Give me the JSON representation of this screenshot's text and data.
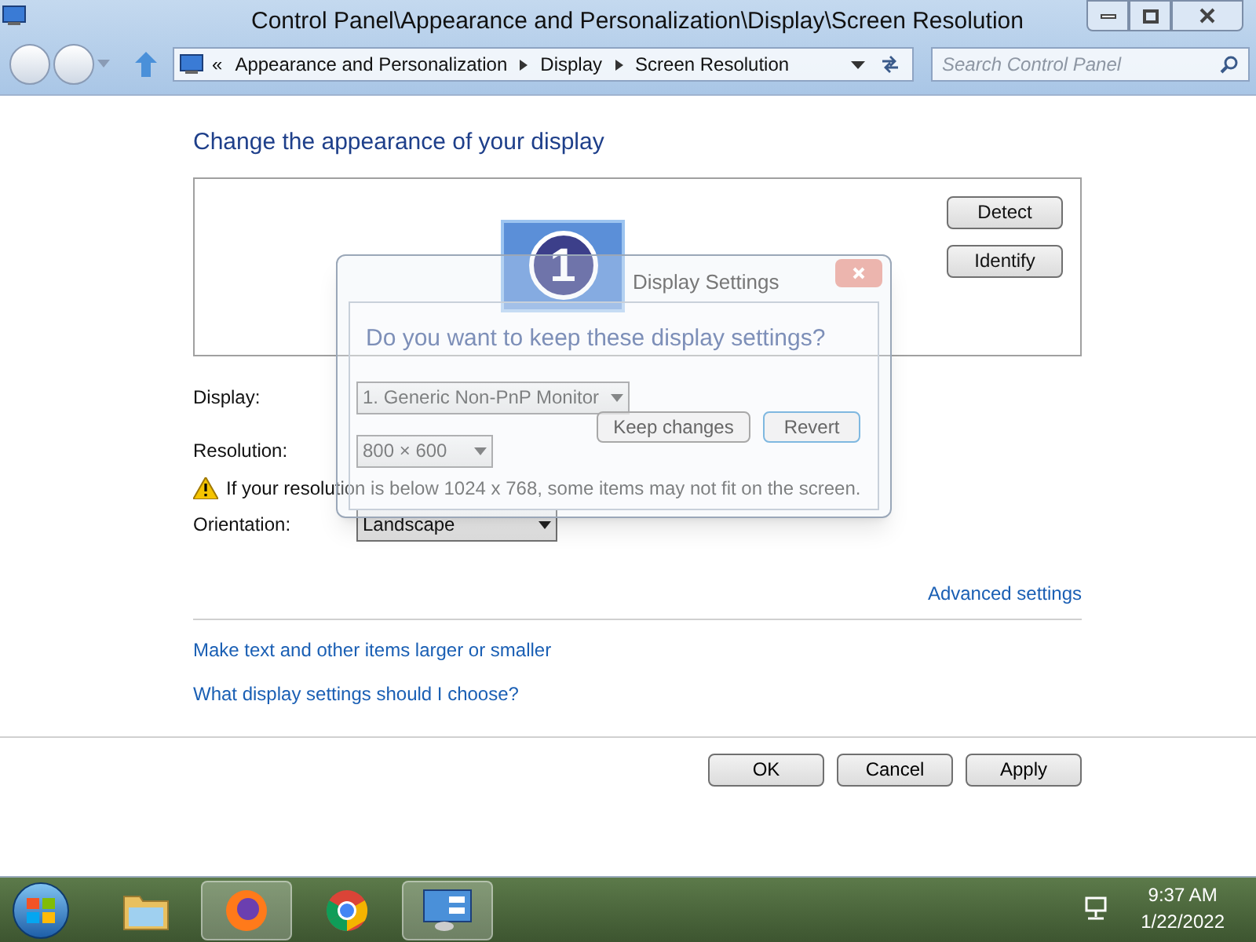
{
  "window": {
    "title": "Control Panel\\Appearance and Personalization\\Display\\Screen Resolution"
  },
  "address_bar": {
    "chevron": "«",
    "breadcrumbs": [
      "Appearance and Personalization",
      "Display",
      "Screen Resolution"
    ],
    "search_placeholder": "Search Control Panel"
  },
  "heading": "Change the appearance of your display",
  "monitor_preview": {
    "number": "1",
    "buttons": [
      "Detect",
      "Identify"
    ]
  },
  "settings": [
    {
      "label": "Display:",
      "value": "1. Generic Non-PnP Monitor"
    },
    {
      "label": "Resolution:",
      "value": "800 × 600"
    },
    {
      "label": "Orientation:",
      "value": "Landscape"
    }
  ],
  "warning": "If your resolution is below 1024 x 768, some items may not fit on the screen.",
  "advanced_link": "Advanced settings",
  "links": [
    "Make text and other items larger or smaller",
    "What display settings should I choose?"
  ],
  "buttons": [
    "OK",
    "Cancel",
    "Apply"
  ],
  "dialog": {
    "title": "Display Settings",
    "question": "Do you want to keep these display settings?",
    "buttons": [
      {
        "label": "Keep changes",
        "selected": false
      },
      {
        "label": "Revert",
        "selected": true
      }
    ]
  },
  "taskbar": {
    "items": [
      {
        "kind": "folder",
        "selected": false
      },
      {
        "kind": "firefox",
        "selected": true
      },
      {
        "kind": "chrome",
        "selected": false
      },
      {
        "kind": "control-panel",
        "selected": true
      }
    ],
    "time": "9:37 AM",
    "date": "1/22/2022"
  }
}
